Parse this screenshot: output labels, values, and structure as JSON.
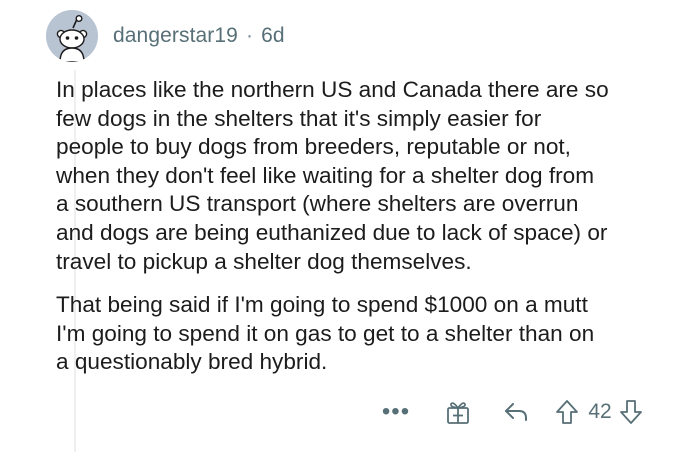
{
  "comment": {
    "author": "dangerstar19",
    "separator": "·",
    "age": "6d",
    "paragraphs": [
      {
        "lines": [
          "In places like the northern US and Canada there are so",
          "few dogs in the shelters that it's simply easier for",
          "people to buy dogs from breeders, reputable or not,",
          "when they don't feel like waiting for a shelter dog from",
          "a southern US transport (where shelters are overrun",
          "and dogs are being euthanized due to lack of space) or",
          "travel to pickup a shelter dog themselves."
        ]
      },
      {
        "lines": [
          "That being said if I'm going to spend $1000 on a mutt",
          "I'm going to spend it on gas to get to a shelter than on",
          "a questionably bred hybrid."
        ]
      }
    ]
  },
  "actions": {
    "more_label": "•••",
    "score": "42",
    "icons": [
      "more-icon",
      "award-icon",
      "reply-icon",
      "upvote-icon",
      "downvote-icon"
    ]
  },
  "colors": {
    "meta_text": "#576f76",
    "body_text": "#1c1c1c",
    "avatar_bg": "#b9c4d3",
    "thread_line": "#edeff1"
  }
}
